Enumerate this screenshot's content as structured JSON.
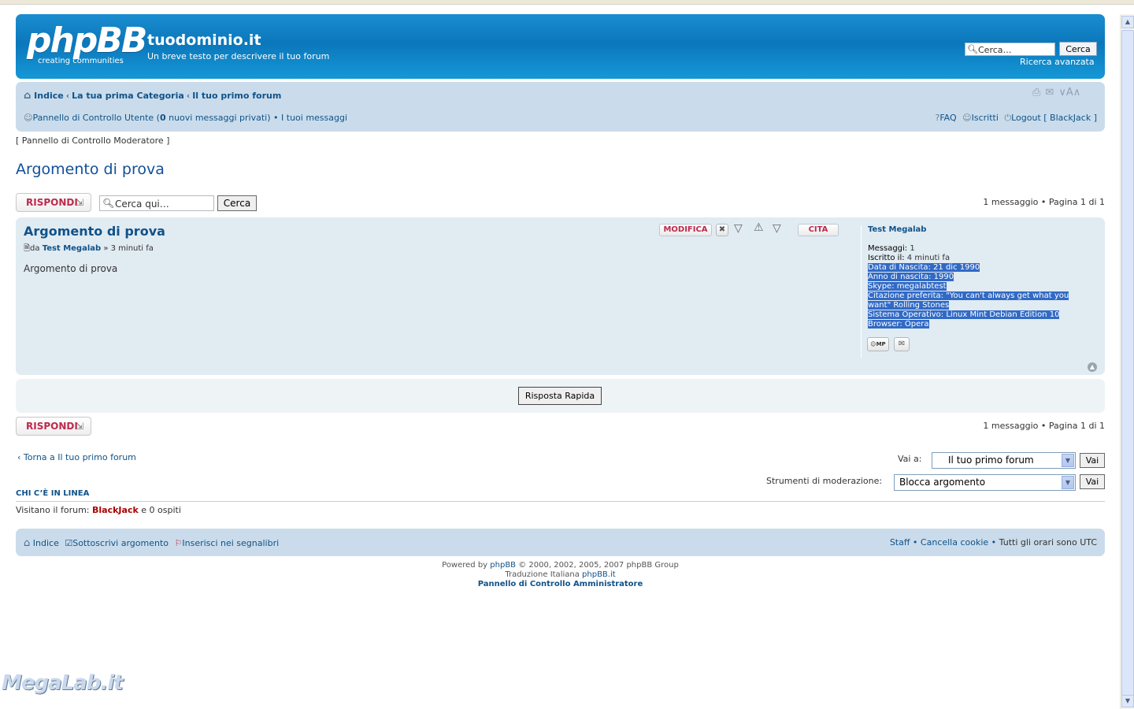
{
  "header": {
    "logo_main": "phpBB",
    "logo_sub": "creating   communities",
    "site_title": "tuodominio.it",
    "site_desc": "Un breve testo per descrivere il tuo forum",
    "search_placeholder": "Cerca…",
    "search_button": "Cerca",
    "advanced_search": "Ricerca avanzata"
  },
  "nav": {
    "crumbs": [
      "Indice",
      "La tua prima Categoria",
      "Il tuo primo forum"
    ],
    "ucp_label": "Pannello di Controllo Utente (",
    "ucp_count": "0",
    "ucp_suffix": " nuovi messaggi privati)",
    "my_posts": "I tuoi messaggi",
    "faq": "FAQ",
    "members": "Iscritti",
    "logout": "Logout [ BlackJack ]"
  },
  "mcp_link": "[ Pannello di Controllo Moderatore ]",
  "topic_title": "Argomento di prova",
  "reply_label": "RISPONDI",
  "topic_search": {
    "placeholder": "Cerca qui…",
    "button": "Cerca"
  },
  "pagination": "1 messaggio • Pagina 1 di 1",
  "post": {
    "title": "Argomento di prova",
    "meta_prefix": "da ",
    "author": "Test Megalab",
    "meta_time": " » 3 minuti fa",
    "body": "Argomento di prova",
    "edit_label": "MODIFICA",
    "quote_label": "CITA"
  },
  "profile": {
    "name": "Test Megalab",
    "posts_label": "Messaggi:",
    "posts_value": " 1",
    "joined_label": "Iscritto il:",
    "joined_value": " 4 minuti fa",
    "fields": [
      "Data di Nascita: 21 dic 1990",
      "Anno di nascita: 1990",
      "Skype: megalabtest",
      "Citazione preferita: \"You can't always get what you",
      "want\" Rolling Stones",
      "Sistema Operativo: Linux Mint Debian Edition 10",
      "Browser: Opera"
    ],
    "pm_label": "MP"
  },
  "quick_reply": "Risposta Rapida",
  "back_link": "Torna a Il tuo primo forum",
  "jump": {
    "label": "Vai a:",
    "selected": "Il tuo primo forum",
    "button": "Vai"
  },
  "mod_tools": {
    "label": "Strumenti di moderazione:",
    "selected": "Blocca argomento",
    "button": "Vai"
  },
  "online": {
    "heading": "CHI C’È IN LINEA",
    "prefix": "Visitano il forum: ",
    "user": "BlackJack",
    "suffix": " e 0 ospiti"
  },
  "footer": {
    "index": "Indice",
    "subscribe": "Sottoscrivi argomento",
    "bookmark": "Inserisci nei segnalibri",
    "staff": "Staff",
    "cookies": "Cancella cookie",
    "timezone": "Tutti gli orari sono UTC"
  },
  "copyright": {
    "line1_prefix": "Powered by ",
    "line1_link": "phpBB",
    "line1_suffix": " © 2000, 2002, 2005, 2007 phpBB Group",
    "line2_prefix": "Traduzione Italiana ",
    "line2_link": "phpBB.it",
    "line3": "Pannello di Controllo Amministratore"
  },
  "watermark": "MegaLab.it",
  "colors": {
    "header_blue": "#0b77bb",
    "nav_bg": "#cadceb",
    "post_bg": "#e1ebf2",
    "link": "#105289",
    "reply_red": "#bc2a4d",
    "highlight": "#316ac5"
  }
}
